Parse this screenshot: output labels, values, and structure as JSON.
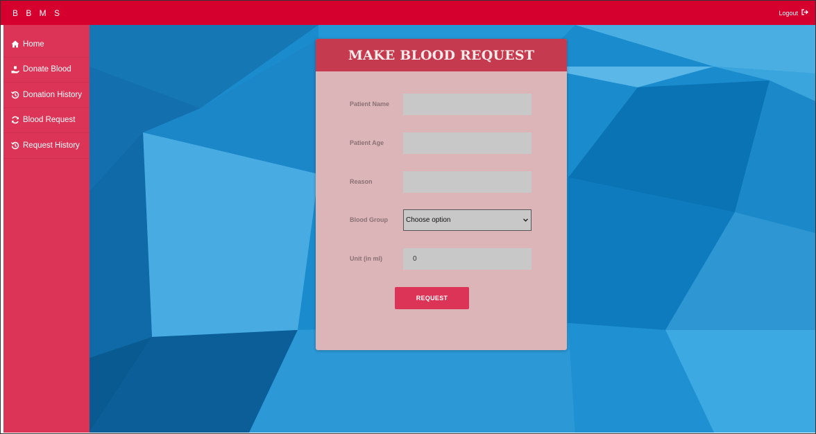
{
  "navbar": {
    "brand": "B B M S",
    "logout_label": "Logout"
  },
  "sidebar": {
    "items": [
      {
        "label": "Home",
        "icon": "home-icon"
      },
      {
        "label": "Donate Blood",
        "icon": "hand-holding-icon"
      },
      {
        "label": "Donation History",
        "icon": "history-icon"
      },
      {
        "label": "Blood Request",
        "icon": "sync-icon"
      },
      {
        "label": "Request History",
        "icon": "history-icon"
      }
    ]
  },
  "form": {
    "title": "MAKE BLOOD REQUEST",
    "patient_name_label": "Patient Name",
    "patient_name_value": "",
    "patient_age_label": "Patient Age",
    "patient_age_value": "",
    "reason_label": "Reason",
    "reason_value": "",
    "blood_group_label": "Blood Group",
    "blood_group_selected": "Choose option",
    "unit_label": "Unit (in ml)",
    "unit_value": "0",
    "submit_label": "REQUEST"
  },
  "colors": {
    "navbar": "#d6002f",
    "sidebar": "#dc3457",
    "card_header": "#c63a4f",
    "card_body": "#dcb5b8",
    "button": "#dc3457",
    "background": "#1a8fd0"
  }
}
